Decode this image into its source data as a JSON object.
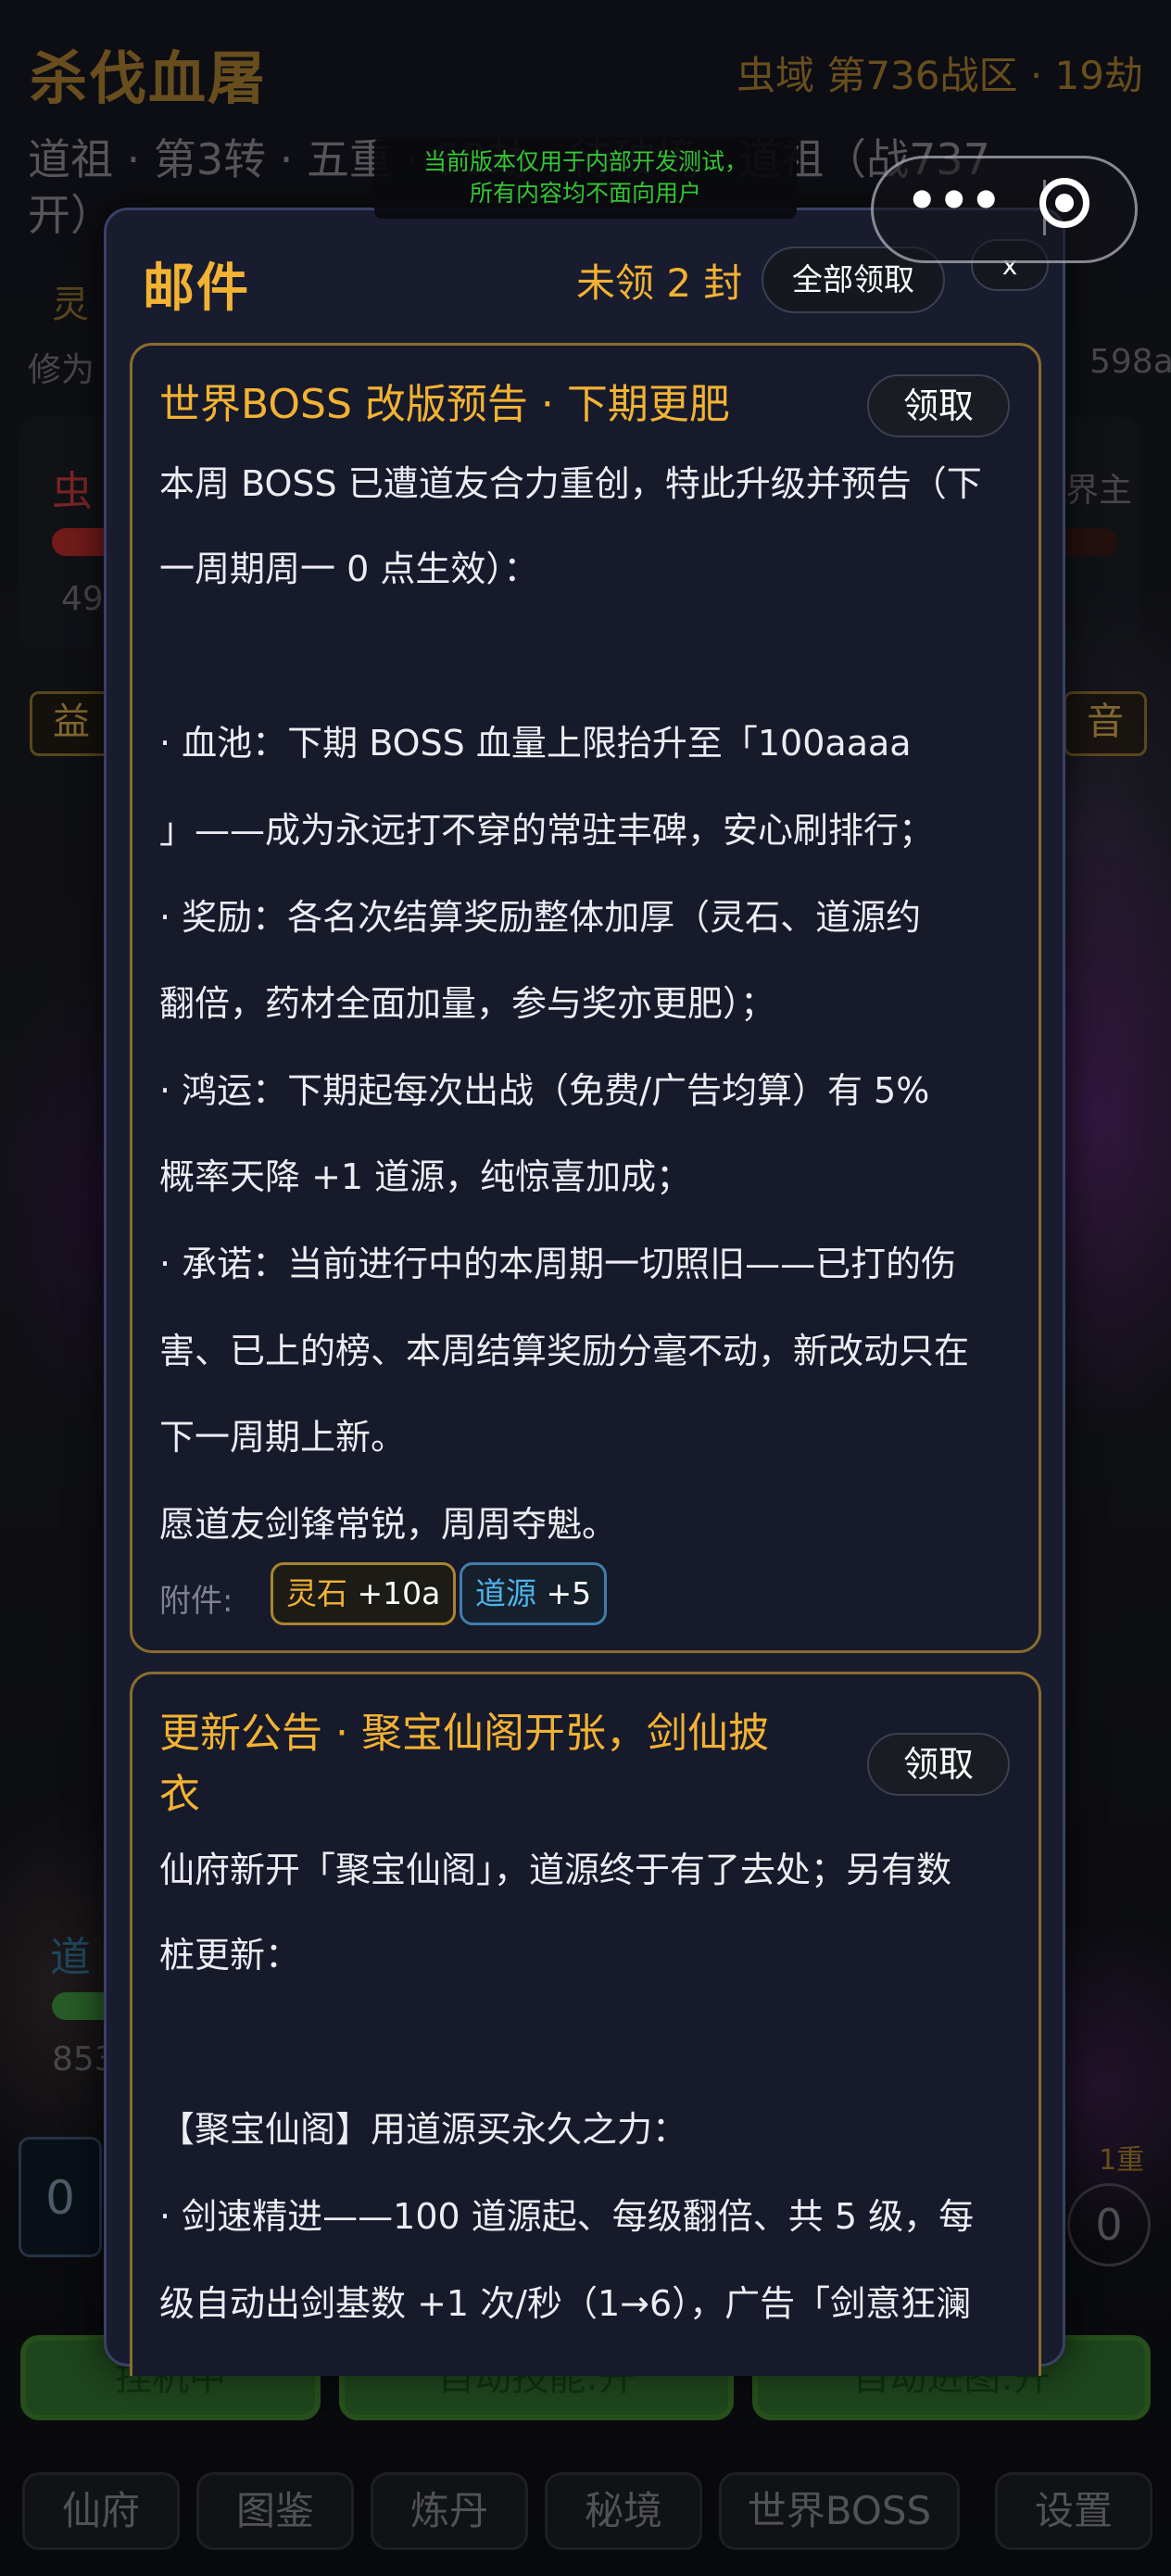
{
  "header": {
    "game_title": "杀伐血屠",
    "zone": "虫域 第736战区 · 19劫",
    "realm_line1": "道祖 · 第3转 · 五重 · 60劫 · 待破境 · 道祖（战737",
    "realm_line2": "开）",
    "obscured_ling": "灵",
    "obscured_xiu": "修为",
    "obscured_right": "598a"
  },
  "dev_banner": {
    "line1": "当前版本仅用于内部开发测试，",
    "line2": "所有内容均不面向用户"
  },
  "capsule": {
    "more_icon": "more-dots-icon",
    "close_icon": "target-circle-icon",
    "more_glyph": "•••"
  },
  "background_ui": {
    "boss_label": "虫",
    "boss_value": "49",
    "world_lord": "界主",
    "tag_left": "益",
    "tag_right": "音",
    "dao_label": "道",
    "dao_value": "853",
    "level_badge": "1重",
    "slot_left": "0",
    "slot_right": "0"
  },
  "bottom_buttons": [
    "挂机中",
    "自动技能:开",
    "自动进图:开"
  ],
  "nav": [
    "仙府",
    "图鉴",
    "炼丹",
    "秘境",
    "世界BOSS",
    "设置"
  ],
  "mail": {
    "title": "邮件",
    "unread": "未领 2 封",
    "claim_all": "全部领取",
    "close": "x",
    "claim": "领取",
    "attach_label": "附件:",
    "messages": [
      {
        "title": "世界BOSS 改版预告 · 下期更肥",
        "lines": [
          "本周 BOSS 已遭道友合力重创，特此升级并预告（下",
          "一周期周一 0 点生效）：",
          "",
          "· 血池：下期 BOSS 血量上限抬升至「100aaaa",
          "」——成为永远打不穿的常驻丰碑，安心刷排行；",
          "· 奖励：各名次结算奖励整体加厚（灵石、道源约",
          "翻倍，药材全面加量，参与奖亦更肥）；",
          "· 鸿运：下期起每次出战（免费/广告均算）有 5%",
          "概率天降 +1 道源，纯惊喜加成；",
          "· 承诺：当前进行中的本周期一切照旧——已打的伤",
          "害、已上的榜、本周结算奖励分毫不动，新改动只在",
          "下一周期上新。",
          "愿道友剑锋常锐，周周夺魁。"
        ],
        "attachments": [
          {
            "name": "灵石",
            "amount": "+10a",
            "color": "#f2b233"
          },
          {
            "name": "道源",
            "amount": "+5",
            "color": "#4fb3ea"
          }
        ]
      },
      {
        "title_line1": "更新公告 · 聚宝仙阁开张，剑仙披",
        "title_line2": "衣",
        "lines": [
          "仙府新开「聚宝仙阁」，道源终于有了去处；另有数",
          "桩更新：",
          "",
          "【聚宝仙阁】用道源买永久之力：",
          "· 剑速精进——100 道源起、每级翻倍、共 5 级，每",
          "级自动出剑基数 +1 次/秒（1→6），广告「剑意狂澜"
        ]
      }
    ]
  },
  "colors": {
    "gold": "#f2b233",
    "panel_bg": "#181c2e",
    "card_border": "#8a6d2e",
    "dev_green": "#35c535",
    "blue_chip": "#4fb3ea"
  }
}
